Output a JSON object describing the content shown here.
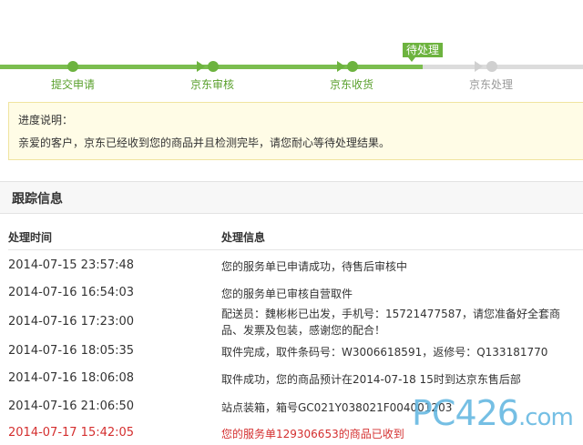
{
  "progress": {
    "steps": [
      {
        "label": "提交申请",
        "state": "done"
      },
      {
        "label": "京东审核",
        "state": "done"
      },
      {
        "label": "京东收货",
        "state": "done"
      },
      {
        "label": "京东处理",
        "state": "pending"
      }
    ],
    "current_tag": "待处理",
    "colors": {
      "done": "#6db33f",
      "pending": "#d0d0d0"
    }
  },
  "notice": {
    "title": "进度说明：",
    "text": "亲爱的客户，京东已经收到您的商品并且检测完毕，请您耐心等待处理结果。"
  },
  "tracking": {
    "title": "跟踪信息",
    "columns": {
      "time": "处理时间",
      "info": "处理信息"
    },
    "rows": [
      {
        "time": "2014-07-15 23:57:48",
        "info": "您的服务单已申请成功，待售后审核中"
      },
      {
        "time": "2014-07-16 16:54:03",
        "info": "您的服务单已审核自营取件"
      },
      {
        "time": "2014-07-16 17:23:00",
        "info": "配送员：魏彬彬已出发，手机号：15721477587，请您准备好全套商品、发票及包装，感谢您的配合！"
      },
      {
        "time": "2014-07-16 18:05:35",
        "info": "取件完成，取件条码号：W3006618591，返修号：Q133181770"
      },
      {
        "time": "2014-07-16 18:06:08",
        "info": "取件成功，您的商品预计在2014-07-18 15时到达京东售后部"
      },
      {
        "time": "2014-07-16 21:06:50",
        "info": "站点装箱，箱号GC021Y038021F004001203"
      },
      {
        "time": "2014-07-17 15:42:05",
        "info": "您的服务单129306653的商品已收到"
      }
    ],
    "highlight_color": "#d42f2f"
  },
  "watermark": {
    "text": "PC426",
    "suffix": ".com"
  }
}
